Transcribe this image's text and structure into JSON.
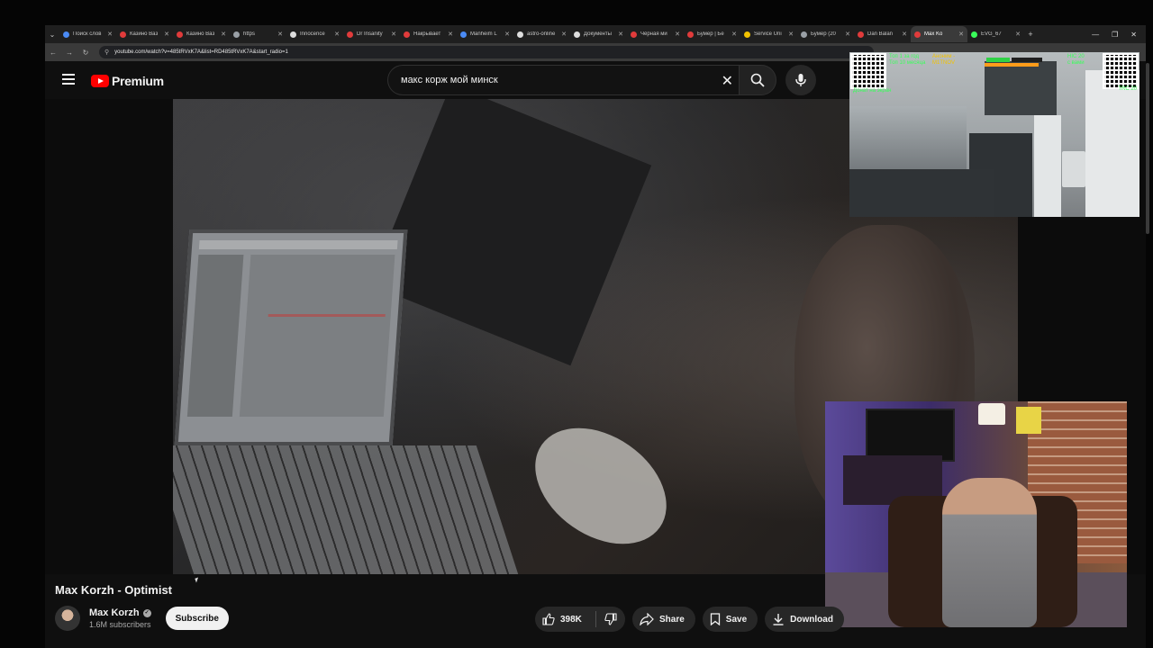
{
  "browser": {
    "tabs": [
      {
        "label": "Поиск слов",
        "color": "#4a8af4"
      },
      {
        "label": "Казино Ваз",
        "color": "#e03b3b"
      },
      {
        "label": "Казино Ваз",
        "color": "#e03b3b"
      },
      {
        "label": "https",
        "color": "#9aa0a6"
      },
      {
        "label": "Innocence",
        "color": "#dddddd"
      },
      {
        "label": "Dr Insanity",
        "color": "#e03b3b"
      },
      {
        "label": "Накрывает",
        "color": "#e03b3b"
      },
      {
        "label": "Manheim L",
        "color": "#4a8af4"
      },
      {
        "label": "astro-online",
        "color": "#dddddd"
      },
      {
        "label": "Документы",
        "color": "#dddddd"
      },
      {
        "label": "Чёрная ми",
        "color": "#e03b3b"
      },
      {
        "label": "Бумер | Бе",
        "color": "#e03b3b"
      },
      {
        "label": "Service Uni",
        "color": "#f2c200"
      },
      {
        "label": "Бумер (20",
        "color": "#9aa0a6"
      },
      {
        "label": "Dan Balan",
        "color": "#e03b3b"
      },
      {
        "label": "Max Ko",
        "color": "#e03b3b",
        "active": true
      },
      {
        "label": "EVG_67",
        "color": "#39ff5a"
      }
    ],
    "url": "youtube.com/watch?v=485tRVxK7A&list=RD485tRVxK7A&start_radio=1"
  },
  "header": {
    "brand": "Premium",
    "search_query": "макс корж мой минск"
  },
  "video": {
    "title": "Max Korzh - Optimist",
    "channel_name": "Max Korzh",
    "subscribers": "1.6M subscribers",
    "subscribe_label": "Subscribe",
    "likes": "398K",
    "share_label": "Share",
    "save_label": "Save",
    "download_label": "Download"
  },
  "overlay": {
    "top_line1": "Топ 1 за год",
    "top_line2": "Топ 10 месяца",
    "qr_caption": "Донат на экран",
    "donate_line1": "Аноним -",
    "donate_line2": "M1TNOV",
    "right_line1": "HIC 20",
    "right_line2": "с вами",
    "right_caption": "TRC 20"
  }
}
